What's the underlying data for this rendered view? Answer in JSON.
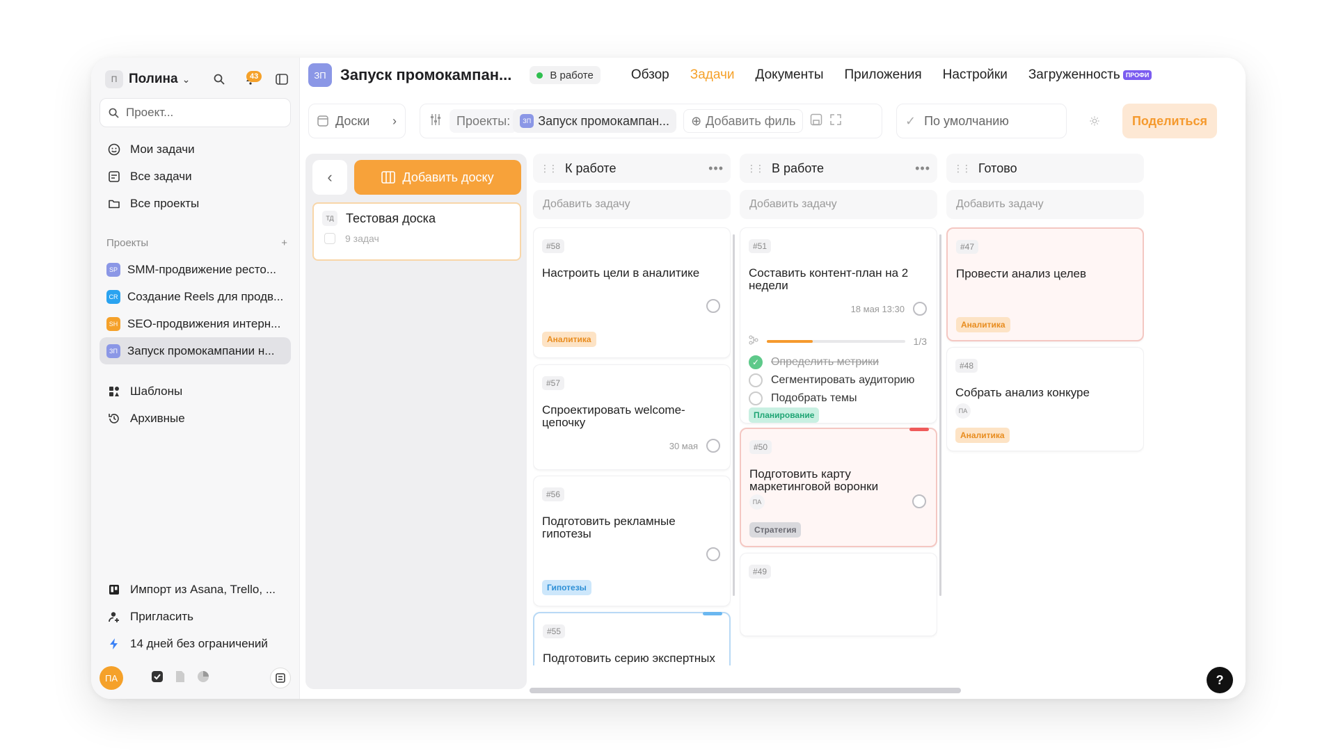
{
  "sidebar": {
    "user_initial": "П",
    "user_name": "Полина",
    "notif_count": "43",
    "search_placeholder": "Проект...",
    "nav": [
      {
        "label": "Мои задачи"
      },
      {
        "label": "Все задачи"
      },
      {
        "label": "Все проекты"
      }
    ],
    "projects_header": "Проекты",
    "projects": [
      {
        "tag": "SP",
        "color": "#8b97e6",
        "label": "SMM-продвижение ресто..."
      },
      {
        "tag": "CR",
        "color": "#2aa3f0",
        "label": "Создание Reels для продв..."
      },
      {
        "tag": "SH",
        "color": "#f5a12a",
        "label": "SEO-продвижения интерн..."
      },
      {
        "tag": "ЗП",
        "color": "#8b97e6",
        "label": "Запуск промокампании н..."
      }
    ],
    "extra": [
      {
        "label": "Шаблоны"
      },
      {
        "label": "Архивные"
      }
    ],
    "bottom": [
      {
        "label": "Импорт из Asana, Trello, ..."
      },
      {
        "label": "Пригласить"
      },
      {
        "label": "14 дней без ограничений"
      }
    ],
    "footer_avatar": "ПА"
  },
  "topbar": {
    "project_tag": "ЗП",
    "project_title": "Запуск промокампан...",
    "status": "В работе",
    "status_color": "#2fbf4f",
    "tabs": [
      "Обзор",
      "Задачи",
      "Документы",
      "Приложения",
      "Настройки",
      "Загруженность"
    ],
    "pro_badge": "ПРОФИ",
    "active_tab": "Задачи"
  },
  "toolbar": {
    "boards_label": "Доски",
    "projects_label": "Проекты:",
    "project_chip_tag": "ЗП",
    "project_chip": "Запуск промокампан...",
    "add_filter": "Добавить филь",
    "default_view": "По умолчанию",
    "share": "Поделиться"
  },
  "boards": {
    "add_board": "Добавить доску",
    "board_tag": "ТД",
    "board_name": "Тестовая доска",
    "board_count": "9 задач"
  },
  "columns": [
    {
      "title": "К работе",
      "add_task": "Добавить задачу",
      "cards": [
        {
          "num": "#58",
          "title": "Настроить цели в аналитике",
          "label": "Аналитика"
        },
        {
          "num": "#57",
          "title": "Спроектировать welcome-цепочку",
          "date": "30 мая"
        },
        {
          "num": "#56",
          "title": "Подготовить рекламные гипотезы",
          "label": "Гипотезы"
        },
        {
          "num": "#55",
          "title": "Подготовить серию экспертных"
        }
      ]
    },
    {
      "title": "В работе",
      "add_task": "Добавить задачу",
      "cards": [
        {
          "num": "#51",
          "title": "Составить контент-план на 2 недели",
          "date": "18 мая 13:30",
          "progress_text": "1/3",
          "progress": 0.33,
          "subtasks": [
            {
              "label": "Определить метрики",
              "done": true
            },
            {
              "label": "Сегментировать аудиторию",
              "done": false
            },
            {
              "label": "Подобрать темы",
              "done": false
            }
          ],
          "label": "Планирование"
        },
        {
          "num": "#50",
          "title": "Подготовить карту маркетинговой воронки",
          "assignee": "ПА",
          "label": "Стратегия"
        },
        {
          "num": "#49",
          "title": ""
        }
      ]
    },
    {
      "title": "Готово",
      "add_task": "Добавить задачу",
      "cards": [
        {
          "num": "#47",
          "title": "Провести анализ целев",
          "label": "Аналитика"
        },
        {
          "num": "#48",
          "title": "Собрать анализ конкуре",
          "assignee": "ПА",
          "label": "Аналитика"
        }
      ]
    }
  ],
  "help": "?"
}
